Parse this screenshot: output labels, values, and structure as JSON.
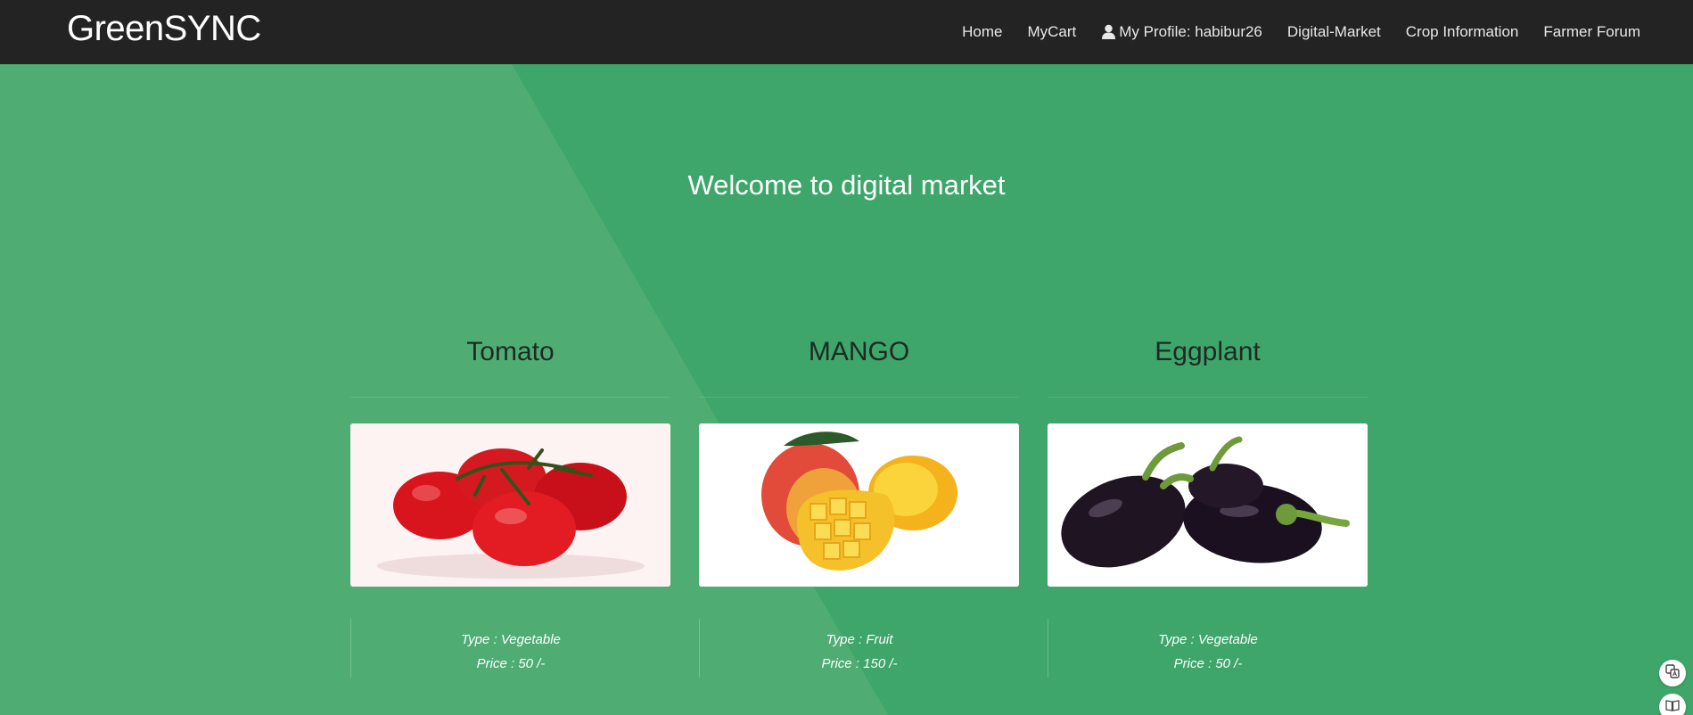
{
  "brand": "GreenSYNC",
  "nav": {
    "home": "Home",
    "mycart": "MyCart",
    "profile": "My Profile: habibur26",
    "market": "Digital-Market",
    "crop": "Crop Information",
    "forum": "Farmer Forum"
  },
  "hero": {
    "title": "Welcome to digital market"
  },
  "products": [
    {
      "name": "Tomato",
      "type": "Type : Vegetable",
      "price": "Price : 50 /-"
    },
    {
      "name": "MANGO",
      "type": "Type : Fruit",
      "price": "Price : 150 /-"
    },
    {
      "name": "Eggplant",
      "type": "Type : Vegetable",
      "price": "Price : 50 /-"
    }
  ],
  "colors": {
    "navbar": "#222322",
    "background": "#3ea66a",
    "light_panel": "#4fad73"
  },
  "icons": [
    "user-icon",
    "translate-icon",
    "reader-icon"
  ]
}
